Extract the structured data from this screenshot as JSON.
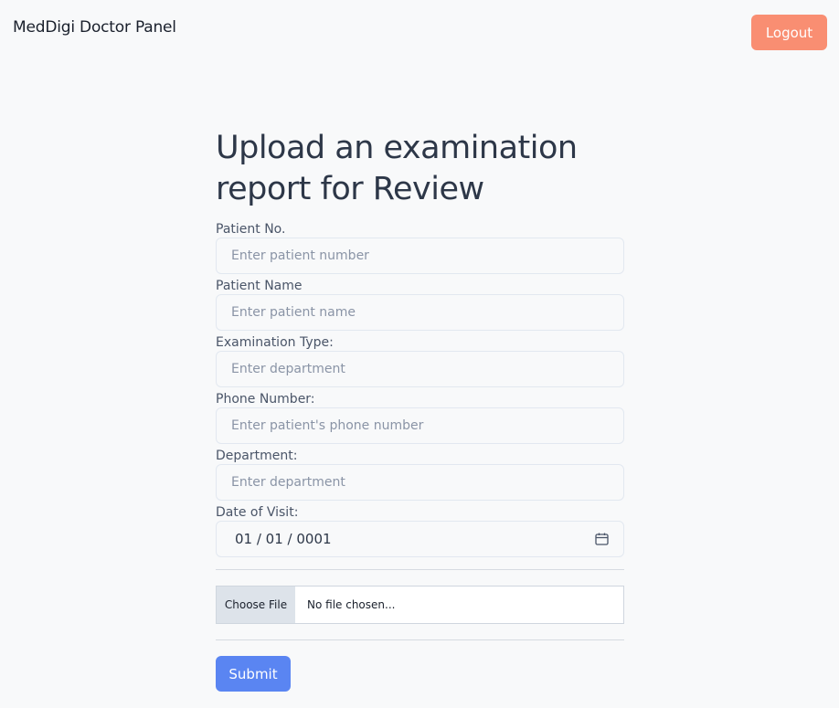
{
  "header": {
    "brand": "MedDigi Doctor Panel",
    "logout_label": "Logout"
  },
  "form": {
    "title": "Upload an examination report for Review",
    "fields": [
      {
        "label": "Patient No.",
        "placeholder": "Enter patient number",
        "value": ""
      },
      {
        "label": "Patient Name",
        "placeholder": "Enter patient name",
        "value": ""
      },
      {
        "label": "Examination Type:",
        "placeholder": "Enter department",
        "value": ""
      },
      {
        "label": "Phone Number:",
        "placeholder": "Enter patient's phone number",
        "value": ""
      },
      {
        "label": "Department:",
        "placeholder": "Enter department",
        "value": ""
      }
    ],
    "date": {
      "label": "Date of Visit:",
      "value": "01 / 01 / 0001",
      "icon": "calendar-icon"
    },
    "file": {
      "button_label": "Choose File",
      "status": "No file chosen..."
    },
    "submit_label": "Submit"
  },
  "colors": {
    "background": "#f8f9fa",
    "logout": "#f98e72",
    "submit": "#5a85f2",
    "border": "#e2e8f0"
  }
}
